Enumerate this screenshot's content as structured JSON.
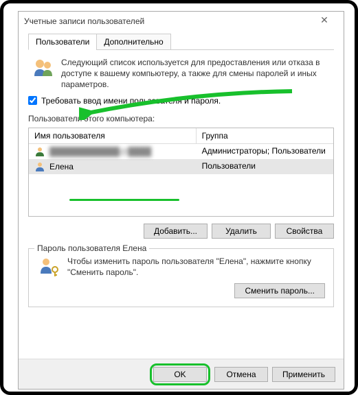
{
  "window": {
    "title": "Учетные записи пользователей"
  },
  "tabs": {
    "users": "Пользователи",
    "advanced": "Дополнительно"
  },
  "description": "Следующий список используется для предоставления или отказа в доступе к вашему компьютеру, а также для смены паролей и иных параметров.",
  "checkbox": {
    "label": "Требовать ввод имени пользователя и пароля.",
    "checked": true
  },
  "users_section": {
    "label": "Пользователи этого компьютера:",
    "columns": {
      "name": "Имя пользователя",
      "group": "Группа"
    },
    "rows": [
      {
        "name": "████████████@████",
        "group": "Администраторы; Пользователи",
        "blurred": true
      },
      {
        "name": "Елена",
        "group": "Пользователи",
        "selected": true
      }
    ],
    "buttons": {
      "add": "Добавить...",
      "remove": "Удалить",
      "properties": "Свойства"
    }
  },
  "password_section": {
    "legend": "Пароль пользователя Елена",
    "text": "Чтобы изменить пароль пользователя \"Елена\", нажмите кнопку \"Сменить пароль\".",
    "button": "Сменить пароль..."
  },
  "bottom": {
    "ok": "OK",
    "cancel": "Отмена",
    "apply": "Применить"
  },
  "highlight_color": "#18c02c"
}
